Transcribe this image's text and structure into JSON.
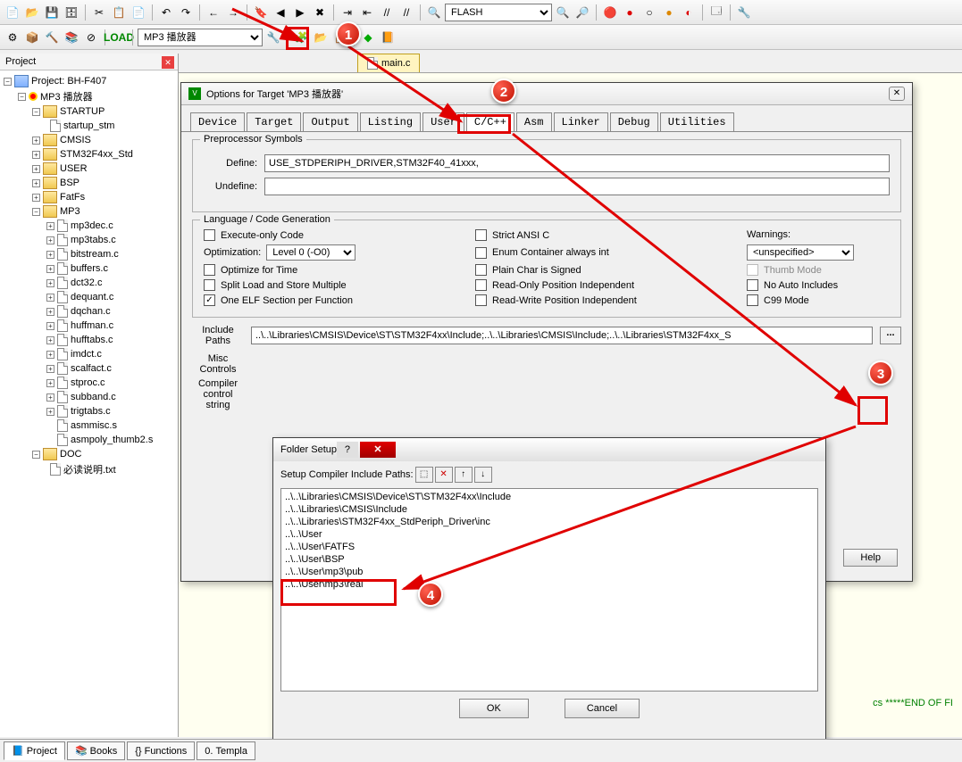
{
  "toolbar": {
    "combo_dropdown": "FLASH",
    "target_combo": "MP3 播放器"
  },
  "project_panel": {
    "title": "Project",
    "root": "Project: BH-F407",
    "target": "MP3 播放器",
    "folders": [
      {
        "name": "STARTUP",
        "expanded": true,
        "files": [
          "startup_stm"
        ]
      },
      {
        "name": "CMSIS",
        "expanded": false
      },
      {
        "name": "STM32F4xx_Std",
        "expanded": false,
        "truncated": true
      },
      {
        "name": "USER",
        "expanded": false
      },
      {
        "name": "BSP",
        "expanded": false
      },
      {
        "name": "FatFs",
        "expanded": false
      },
      {
        "name": "MP3",
        "expanded": true,
        "files": [
          "mp3dec.c",
          "mp3tabs.c",
          "bitstream.c",
          "buffers.c",
          "dct32.c",
          "dequant.c",
          "dqchan.c",
          "huffman.c",
          "hufftabs.c",
          "imdct.c",
          "scalfact.c",
          "stproc.c",
          "subband.c",
          "trigtabs.c",
          "asmmisc.s",
          "asmpoly_thumb2.s"
        ]
      },
      {
        "name": "DOC",
        "expanded": true,
        "files": [
          "必读说明.txt"
        ]
      }
    ]
  },
  "bottom_tabs": [
    "Project",
    "Books",
    "Functions",
    "Templa"
  ],
  "editor": {
    "tab": "main.c",
    "visible_text": "cs *****END OF FI"
  },
  "options_dialog": {
    "title": "Options for Target 'MP3 播放器'",
    "tabs": [
      "Device",
      "Target",
      "Output",
      "Listing",
      "User",
      "C/C++",
      "Asm",
      "Linker",
      "Debug",
      "Utilities"
    ],
    "active_tab": "C/C++",
    "preprocessor": {
      "legend": "Preprocessor Symbols",
      "define_label": "Define:",
      "define_value": "USE_STDPERIPH_DRIVER,STM32F40_41xxx,",
      "undefine_label": "Undefine:",
      "undefine_value": ""
    },
    "lang": {
      "legend": "Language / Code Generation",
      "execute_only": "Execute-only Code",
      "optimization_label": "Optimization:",
      "optimization_value": "Level 0 (-O0)",
      "optimize_time": "Optimize for Time",
      "split_load": "Split Load and Store Multiple",
      "one_elf": "One ELF Section per Function",
      "strict_ansi": "Strict ANSI C",
      "enum_container": "Enum Container always int",
      "plain_char": "Plain Char is Signed",
      "ro_pos": "Read-Only Position Independent",
      "rw_pos": "Read-Write Position Independent",
      "warnings_label": "Warnings:",
      "warnings_value": "<unspecified>",
      "thumb_mode": "Thumb Mode",
      "no_auto": "No Auto Includes",
      "c99": "C99 Mode"
    },
    "include_paths_label": "Include Paths",
    "include_paths_value": "..\\..\\Libraries\\CMSIS\\Device\\ST\\STM32F4xx\\Include;..\\..\\Libraries\\CMSIS\\Include;..\\..\\Libraries\\STM32F4xx_S",
    "misc_controls_label": "Misc Controls",
    "compiler_control_label": "Compiler control string",
    "help_button": "Help"
  },
  "folder_setup": {
    "title": "Folder Setup",
    "header": "Setup Compiler Include Paths:",
    "paths": [
      "..\\..\\Libraries\\CMSIS\\Device\\ST\\STM32F4xx\\Include",
      "..\\..\\Libraries\\CMSIS\\Include",
      "..\\..\\Libraries\\STM32F4xx_StdPeriph_Driver\\inc",
      "..\\..\\User",
      "..\\..\\User\\FATFS",
      "..\\..\\User\\BSP",
      "..\\..\\User\\mp3\\pub",
      "..\\..\\User\\mp3\\real"
    ],
    "ok": "OK",
    "cancel": "Cancel"
  },
  "callouts": {
    "c1": "1",
    "c2": "2",
    "c3": "3",
    "c4": "4"
  }
}
